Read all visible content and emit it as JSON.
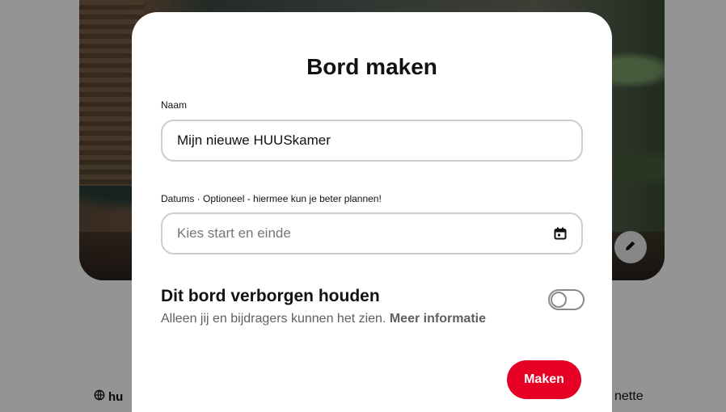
{
  "modal": {
    "title": "Bord maken",
    "name_label": "Naam",
    "name_value": "Mijn nieuwe HUUSkamer",
    "dates_label": "Datums · Optioneel - hiermee kun je beter plannen!",
    "dates_placeholder": "Kies start en einde",
    "secret_title": "Dit bord verborgen houden",
    "secret_desc": "Alleen jij en bijdragers kunnen het zien.",
    "secret_link": "Meer informatie",
    "secret_toggle_on": false,
    "create_label": "Maken"
  },
  "background": {
    "left_text": "hu",
    "right_text": "nette"
  },
  "colors": {
    "primary": "#e60023",
    "overlay": "rgba(0,0,0,0.42)"
  },
  "icons": {
    "date_field": "calendar-icon",
    "edit": "pencil-icon",
    "left_text": "globe-icon"
  }
}
